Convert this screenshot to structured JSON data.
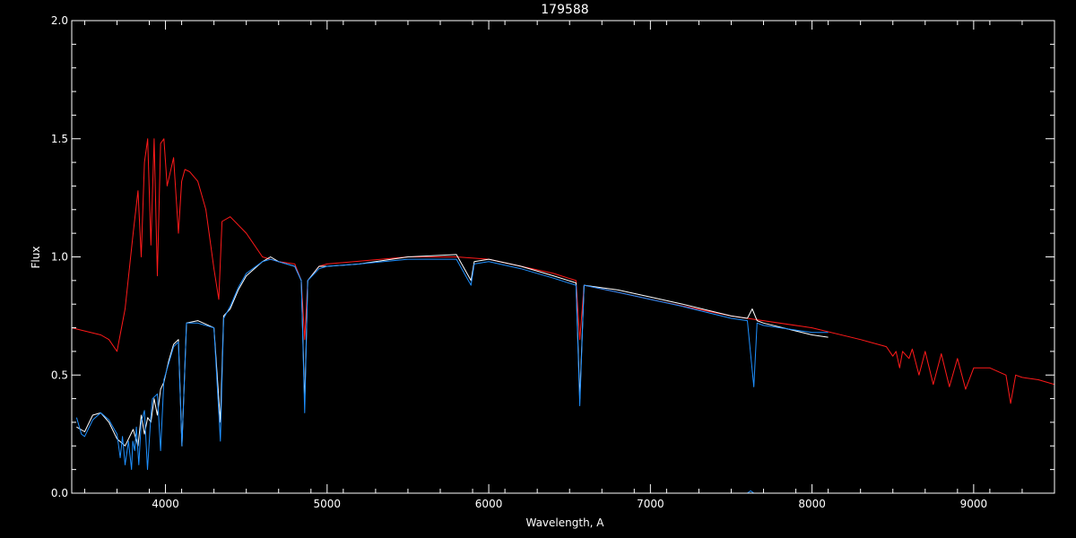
{
  "chart_data": {
    "type": "line",
    "title": "179588",
    "xlabel": "Wavelength, A",
    "ylabel": "Flux",
    "xlim": [
      3420,
      9500
    ],
    "ylim": [
      0,
      2.0
    ],
    "x_ticks": [
      4000,
      5000,
      6000,
      7000,
      8000,
      9000
    ],
    "x_tick_labels": [
      "4000",
      "5000",
      "6000",
      "7000",
      "8000",
      "9000"
    ],
    "y_ticks": [
      0,
      0.5,
      1.0,
      1.5,
      2.0
    ],
    "y_tick_labels": [
      "0.0",
      "0.5",
      "1.0",
      "1.5",
      "2.0"
    ],
    "grid": false,
    "background": "#000000",
    "axis_color": "#ffffff",
    "series": [
      {
        "color": "#ff1a1a",
        "x": [
          3420,
          3600,
          3650,
          3700,
          3750,
          3800,
          3830,
          3850,
          3870,
          3890,
          3910,
          3930,
          3950,
          3970,
          3990,
          4010,
          4050,
          4080,
          4100,
          4120,
          4150,
          4200,
          4250,
          4300,
          4330,
          4350,
          4400,
          4500,
          4600,
          4700,
          4800,
          4840,
          4861,
          4880,
          4950,
          5000,
          5500,
          5800,
          6000,
          6400,
          6540,
          6563,
          6590,
          6800,
          7000,
          7500,
          8000,
          8300,
          8460,
          8500,
          8520,
          8542,
          8560,
          8600,
          8620,
          8662,
          8700,
          8750,
          8800,
          8850,
          8900,
          8950,
          9000,
          9100,
          9200,
          9229,
          9260,
          9300,
          9400,
          9500
        ],
        "y": [
          0.7,
          0.67,
          0.65,
          0.6,
          0.78,
          1.1,
          1.28,
          1.0,
          1.4,
          1.5,
          1.05,
          1.5,
          0.92,
          1.48,
          1.5,
          1.3,
          1.42,
          1.1,
          1.32,
          1.37,
          1.36,
          1.32,
          1.2,
          0.95,
          0.82,
          1.15,
          1.17,
          1.1,
          1.0,
          0.98,
          0.97,
          0.9,
          0.65,
          0.9,
          0.96,
          0.97,
          1.0,
          1.0,
          0.99,
          0.93,
          0.9,
          0.65,
          0.88,
          0.85,
          0.82,
          0.75,
          0.7,
          0.65,
          0.62,
          0.58,
          0.6,
          0.53,
          0.6,
          0.57,
          0.61,
          0.5,
          0.6,
          0.46,
          0.59,
          0.45,
          0.57,
          0.44,
          0.53,
          0.53,
          0.5,
          0.38,
          0.5,
          0.49,
          0.48,
          0.46
        ]
      },
      {
        "color": "#ffffff",
        "x": [
          3450,
          3500,
          3550,
          3600,
          3650,
          3700,
          3750,
          3800,
          3830,
          3850,
          3870,
          3890,
          3910,
          3930,
          3950,
          3970,
          3990,
          4020,
          4050,
          4080,
          4102,
          4130,
          4200,
          4300,
          4340,
          4360,
          4400,
          4450,
          4500,
          4600,
          4650,
          4700,
          4800,
          4840,
          4861,
          4880,
          4950,
          5000,
          5200,
          5500,
          5800,
          5890,
          5910,
          6000,
          6200,
          6400,
          6540,
          6563,
          6590,
          6800,
          7000,
          7200,
          7500,
          7600,
          7630,
          7660,
          7700,
          8000,
          8100
        ],
        "y": [
          0.28,
          0.26,
          0.33,
          0.34,
          0.3,
          0.23,
          0.2,
          0.27,
          0.2,
          0.33,
          0.25,
          0.32,
          0.3,
          0.4,
          0.33,
          0.44,
          0.47,
          0.56,
          0.63,
          0.65,
          0.2,
          0.72,
          0.73,
          0.7,
          0.3,
          0.75,
          0.78,
          0.86,
          0.92,
          0.98,
          1.0,
          0.98,
          0.96,
          0.9,
          0.38,
          0.9,
          0.96,
          0.96,
          0.97,
          1.0,
          1.01,
          0.9,
          0.98,
          0.99,
          0.96,
          0.92,
          0.89,
          0.4,
          0.88,
          0.86,
          0.83,
          0.8,
          0.75,
          0.74,
          0.78,
          0.73,
          0.72,
          0.67,
          0.66
        ]
      },
      {
        "color": "#1e90ff",
        "x": [
          3450,
          3480,
          3500,
          3550,
          3600,
          3650,
          3700,
          3720,
          3734,
          3750,
          3771,
          3790,
          3798,
          3810,
          3820,
          3835,
          3850,
          3870,
          3889,
          3910,
          3920,
          3950,
          3970,
          3990,
          4020,
          4050,
          4080,
          4102,
          4130,
          4200,
          4300,
          4340,
          4360,
          4400,
          4450,
          4500,
          4600,
          4650,
          4700,
          4800,
          4840,
          4861,
          4880,
          4950,
          5000,
          5200,
          5500,
          5800,
          5890,
          5910,
          6000,
          6200,
          6400,
          6540,
          6563,
          6590,
          6800,
          7000,
          7200,
          7500,
          7600,
          7640,
          7660,
          7700,
          8000,
          8100
        ],
        "y": [
          0.32,
          0.25,
          0.24,
          0.31,
          0.34,
          0.31,
          0.25,
          0.15,
          0.24,
          0.12,
          0.22,
          0.1,
          0.22,
          0.18,
          0.28,
          0.12,
          0.3,
          0.35,
          0.1,
          0.33,
          0.4,
          0.42,
          0.18,
          0.48,
          0.55,
          0.62,
          0.64,
          0.2,
          0.72,
          0.72,
          0.7,
          0.22,
          0.74,
          0.79,
          0.87,
          0.93,
          0.98,
          0.99,
          0.98,
          0.96,
          0.9,
          0.34,
          0.9,
          0.95,
          0.96,
          0.97,
          0.99,
          0.99,
          0.88,
          0.97,
          0.98,
          0.95,
          0.91,
          0.88,
          0.37,
          0.88,
          0.85,
          0.82,
          0.79,
          0.74,
          0.73,
          0.45,
          0.72,
          0.71,
          0.68,
          0.68
        ]
      },
      {
        "color": "#1e90ff",
        "x": [
          3450,
          4000,
          5000,
          6000,
          7000,
          7600,
          7620,
          7640,
          7700,
          8100
        ],
        "y": [
          0.0,
          0.0,
          0.0,
          0.0,
          0.0,
          0.0,
          0.01,
          0.0,
          0.0,
          0.0
        ]
      }
    ]
  }
}
